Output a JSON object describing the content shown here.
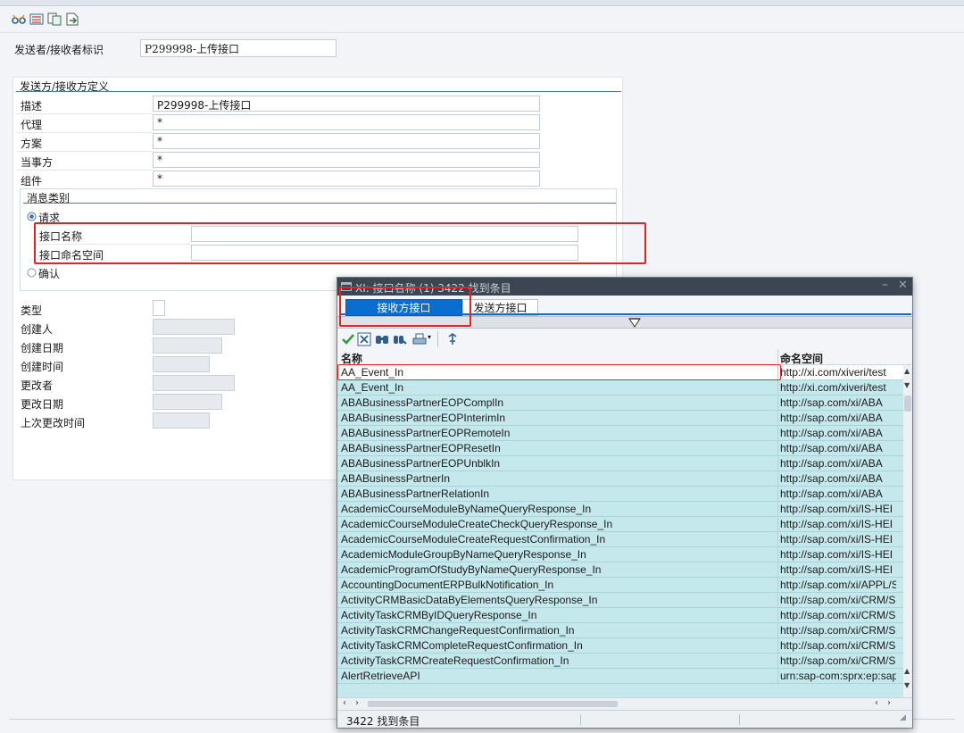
{
  "toolbar": {
    "icons": [
      "glasses-icon",
      "list-icon",
      "copy-icon",
      "export-icon"
    ]
  },
  "header": {
    "sender_label": "发送者/接收者标识",
    "sender_value": "P299998-上传接口"
  },
  "definition": {
    "section_title": "发送方/接收方定义",
    "rows": [
      {
        "label": "描述",
        "value": "P299998-上传接口"
      },
      {
        "label": "代理",
        "value": "*"
      },
      {
        "label": "方案",
        "value": "*"
      },
      {
        "label": "当事方",
        "value": "*"
      },
      {
        "label": "组件",
        "value": "*"
      }
    ],
    "message_type": {
      "title": "消息类别",
      "request_label": "请求",
      "interface_name_label": "接口名称",
      "interface_name_value": "",
      "interface_ns_label": "接口命名空间",
      "interface_ns_value": "",
      "confirm_label": "确认"
    }
  },
  "meta": {
    "type_label": "类型",
    "created_by_label": "创建人",
    "created_date_label": "创建日期",
    "created_time_label": "创建时间",
    "changed_by_label": "更改者",
    "changed_date_label": "更改日期",
    "last_change_time_label": "上次更改时间"
  },
  "popup": {
    "title": "XI: 接口名称 (1) 3422 找到条目",
    "tabs": [
      "接收方接口",
      "发送方接口"
    ],
    "columns": {
      "name": "名称",
      "namespace": "命名空间"
    },
    "rows": [
      {
        "name": "AA_Event_In",
        "ns": "http://xi.com/xiveri/test"
      },
      {
        "name": "AA_Event_In",
        "ns": "http://xi.com/xiveri/test"
      },
      {
        "name": "ABABusinessPartnerEOPComplIn",
        "ns": "http://sap.com/xi/ABA"
      },
      {
        "name": "ABABusinessPartnerEOPInterimIn",
        "ns": "http://sap.com/xi/ABA"
      },
      {
        "name": "ABABusinessPartnerEOPRemoteIn",
        "ns": "http://sap.com/xi/ABA"
      },
      {
        "name": "ABABusinessPartnerEOPResetIn",
        "ns": "http://sap.com/xi/ABA"
      },
      {
        "name": "ABABusinessPartnerEOPUnblkIn",
        "ns": "http://sap.com/xi/ABA"
      },
      {
        "name": "ABABusinessPartnerIn",
        "ns": "http://sap.com/xi/ABA"
      },
      {
        "name": "ABABusinessPartnerRelationIn",
        "ns": "http://sap.com/xi/ABA"
      },
      {
        "name": "AcademicCourseModuleByNameQueryResponse_In",
        "ns": "http://sap.com/xi/IS-HEI"
      },
      {
        "name": "AcademicCourseModuleCreateCheckQueryResponse_In",
        "ns": "http://sap.com/xi/IS-HEI"
      },
      {
        "name": "AcademicCourseModuleCreateRequestConfirmation_In",
        "ns": "http://sap.com/xi/IS-HEI"
      },
      {
        "name": "AcademicModuleGroupByNameQueryResponse_In",
        "ns": "http://sap.com/xi/IS-HEI"
      },
      {
        "name": "AcademicProgramOfStudyByNameQueryResponse_In",
        "ns": "http://sap.com/xi/IS-HEI"
      },
      {
        "name": "AccountingDocumentERPBulkNotification_In",
        "ns": "http://sap.com/xi/APPL/S"
      },
      {
        "name": "ActivityCRMBasicDataByElementsQueryResponse_In",
        "ns": "http://sap.com/xi/CRM/S"
      },
      {
        "name": "ActivityTaskCRMByIDQueryResponse_In",
        "ns": "http://sap.com/xi/CRM/S"
      },
      {
        "name": "ActivityTaskCRMChangeRequestConfirmation_In",
        "ns": "http://sap.com/xi/CRM/S"
      },
      {
        "name": "ActivityTaskCRMCompleteRequestConfirmation_In",
        "ns": "http://sap.com/xi/CRM/S"
      },
      {
        "name": "ActivityTaskCRMCreateRequestConfirmation_In",
        "ns": "http://sap.com/xi/CRM/S"
      },
      {
        "name": "AlertRetrieveAPI",
        "ns": "urn:sap-com:sprx:ep:sap"
      }
    ],
    "status": "3422 找到条目"
  },
  "colors": {
    "accent": "#0a6ed1",
    "highlight": "#e52421",
    "grid_bg": "#c4e8ec"
  }
}
